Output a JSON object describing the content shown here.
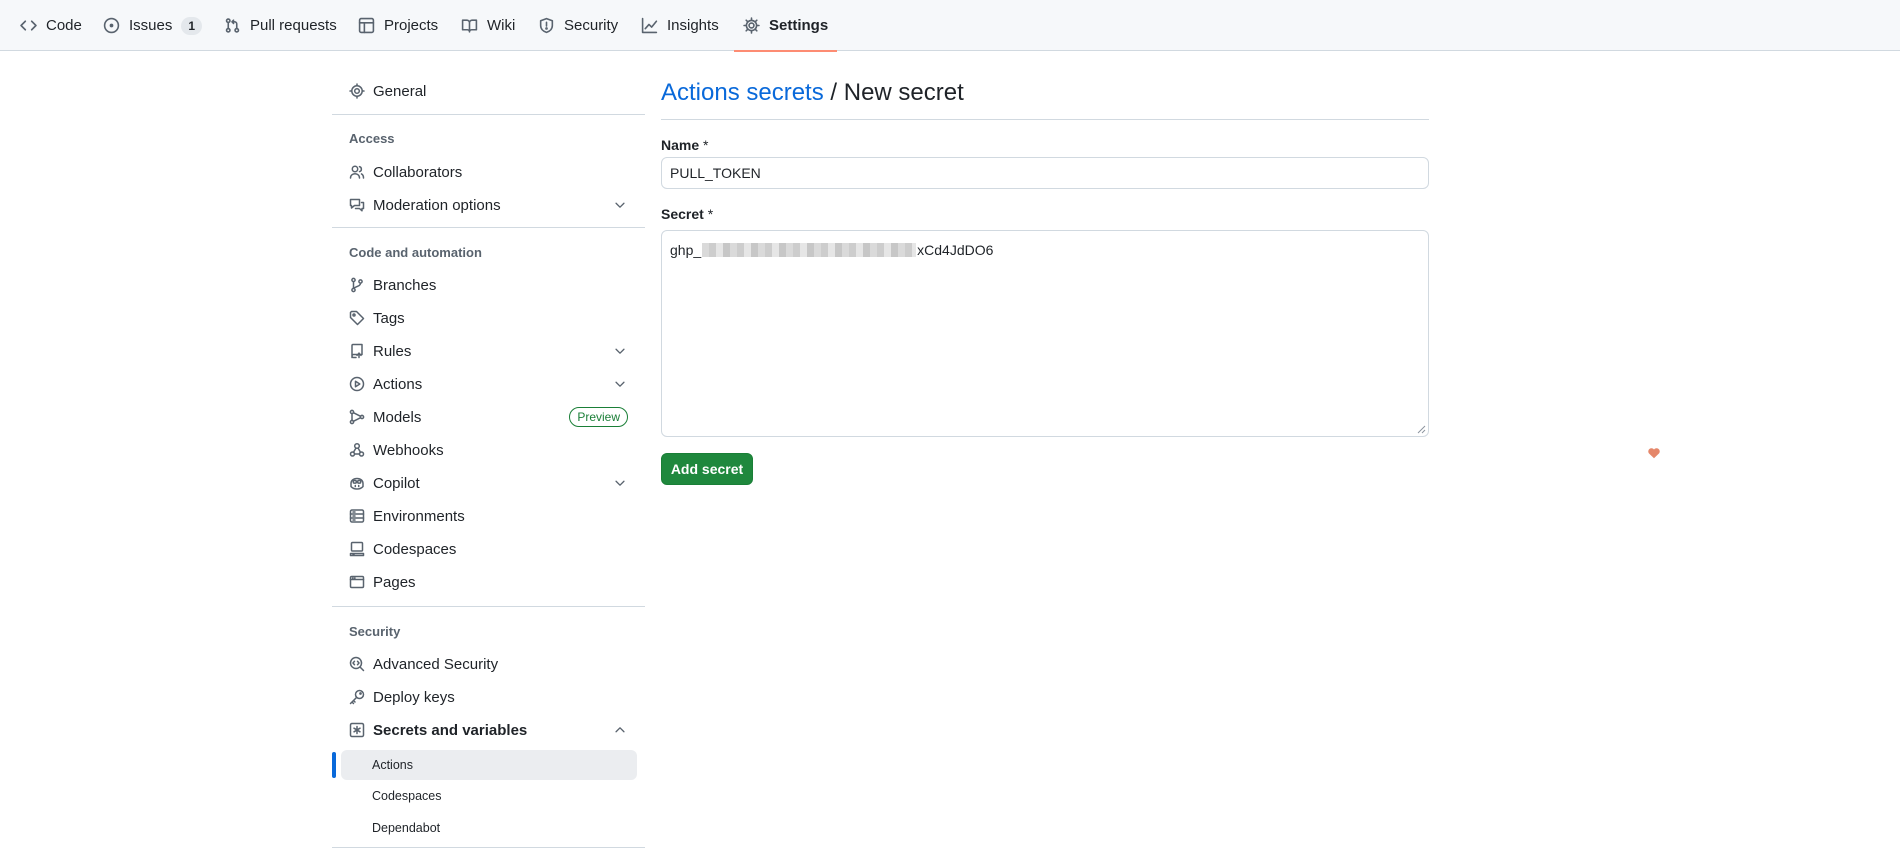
{
  "repo_nav": {
    "tabs": [
      {
        "label": "Code",
        "icon": "code-icon"
      },
      {
        "label": "Issues",
        "icon": "issue-opened-icon",
        "count": "1"
      },
      {
        "label": "Pull requests",
        "icon": "git-pull-request-icon"
      },
      {
        "label": "Projects",
        "icon": "table-icon"
      },
      {
        "label": "Wiki",
        "icon": "book-icon"
      },
      {
        "label": "Security",
        "icon": "shield-icon"
      },
      {
        "label": "Insights",
        "icon": "graph-icon"
      },
      {
        "label": "Settings",
        "icon": "gear-icon",
        "active": true
      }
    ]
  },
  "sidebar": {
    "general": "General",
    "access_heading": "Access",
    "collaborators": "Collaborators",
    "moderation": "Moderation options",
    "automation_heading": "Code and automation",
    "branches": "Branches",
    "tags": "Tags",
    "rules": "Rules",
    "actions": "Actions",
    "models": "Models",
    "models_badge": "Preview",
    "webhooks": "Webhooks",
    "copilot": "Copilot",
    "environments": "Environments",
    "codespaces": "Codespaces",
    "pages": "Pages",
    "security_heading": "Security",
    "advanced_security": "Advanced Security",
    "deploy_keys": "Deploy keys",
    "secrets_and_variables": "Secrets and variables",
    "sub_items": [
      "Actions",
      "Codespaces",
      "Dependabot"
    ],
    "selected_sub_item": "Actions"
  },
  "main": {
    "breadcrumb_link": "Actions secrets",
    "breadcrumb_separator": " / ",
    "page_title": "New secret",
    "name_label": "Name",
    "name_value": "PULL_TOKEN",
    "secret_label": "Secret",
    "required_marker": "*",
    "secret_prefix": "ghp_",
    "secret_suffix": "xCd4JdDO6",
    "submit_label": "Add secret"
  },
  "colors": {
    "accent_link": "#0969da",
    "primary_button": "#1f883d",
    "active_tab_underline": "#fd8c73",
    "badge_green": "#1a7f37"
  }
}
